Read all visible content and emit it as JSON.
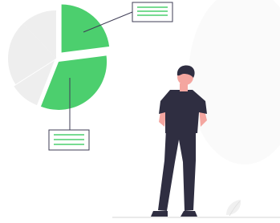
{
  "chart_data": {
    "type": "pie",
    "title": "",
    "slices": [
      {
        "value": 23,
        "color": "#4ccf6e"
      },
      {
        "value": 33,
        "color": "#4ccf6e"
      },
      {
        "value": 10,
        "color": "#eeeeee"
      },
      {
        "value": 22,
        "color": "#eeeeee"
      },
      {
        "value": 12,
        "color": "#eeeeee"
      }
    ]
  },
  "colors": {
    "accent": "#4ccf6e",
    "neutral": "#eeeeee",
    "outline": "#3f3d56",
    "skin": "#f4a6a0",
    "hair": "#2f2e41"
  },
  "icons": {
    "callout_top": "document-lines-icon",
    "callout_bottom": "document-lines-icon",
    "person": "person-illustration",
    "plant": "plant-leaf-icon"
  }
}
